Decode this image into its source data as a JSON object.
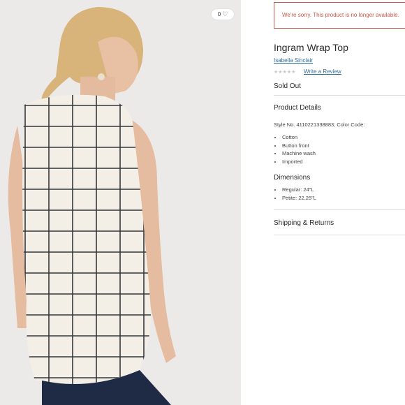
{
  "favorite": {
    "count": "0",
    "icon": "heart-icon"
  },
  "notice": "We're sorry. This product is no longer available.",
  "product": {
    "title": "Ingram Wrap Top",
    "brand": "Isabella Sinclair",
    "rating_stars": "★★★★★",
    "write_review": "Write a Review",
    "status": "Sold Out"
  },
  "details": {
    "heading": "Product Details",
    "style_line": "Style No. 4110221338883; Color Code:",
    "features": [
      "Cotton",
      "Button front",
      "Machine wash",
      "Imported"
    ]
  },
  "dimensions": {
    "heading": "Dimensions",
    "items": [
      "Regular: 24\"L",
      "Petite: 22.25\"L"
    ]
  },
  "shipping": {
    "heading": "Shipping & Returns"
  },
  "colors": {
    "notice": "#c9574a",
    "link": "#2f6ea0"
  }
}
